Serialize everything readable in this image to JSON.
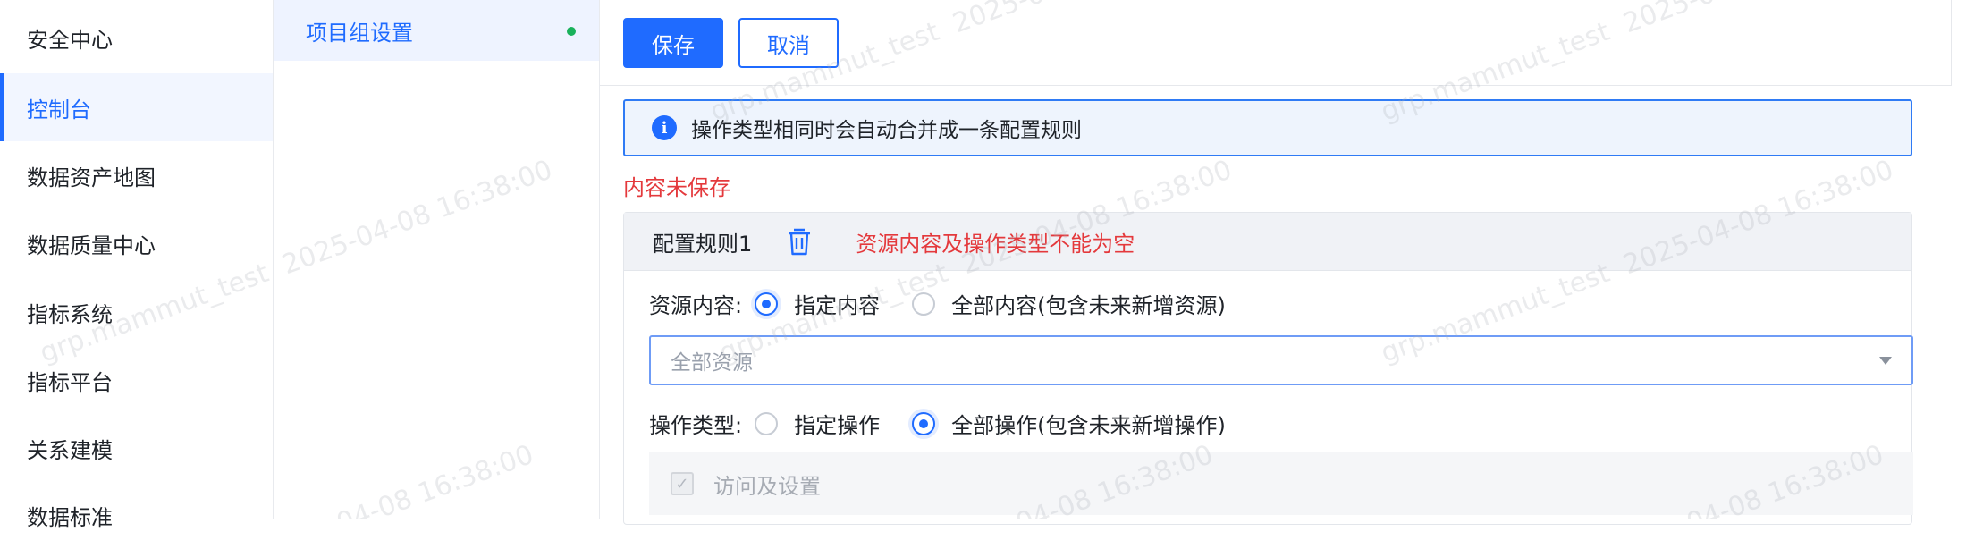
{
  "left_nav": {
    "items": [
      {
        "label": "安全中心",
        "active": false
      },
      {
        "label": "控制台",
        "active": true
      },
      {
        "label": "数据资产地图",
        "active": false
      },
      {
        "label": "数据质量中心",
        "active": false
      },
      {
        "label": "指标系统",
        "active": false
      },
      {
        "label": "指标平台",
        "active": false
      },
      {
        "label": "关系建模",
        "active": false
      },
      {
        "label": "数据标准",
        "active": false
      }
    ]
  },
  "mid_col": {
    "item_label": "项目组设置",
    "status_color": "#19b15b"
  },
  "toolbar": {
    "save_label": "保存",
    "cancel_label": "取消"
  },
  "info": {
    "icon": "info-icon",
    "message": "操作类型相同时会自动合并成一条配置规则"
  },
  "unsaved_text": "内容未保存",
  "rule": {
    "title": "配置规则1",
    "delete_icon": "trash-icon",
    "error": "资源内容及操作类型不能为空",
    "resource": {
      "label": "资源内容:",
      "options": [
        {
          "label": "指定内容",
          "checked": true
        },
        {
          "label": "全部内容(包含未来新增资源)",
          "checked": false
        }
      ],
      "select_placeholder": "全部资源"
    },
    "operation": {
      "label": "操作类型:",
      "options": [
        {
          "label": "指定操作",
          "checked": false
        },
        {
          "label": "全部操作(包含未来新增操作)",
          "checked": true
        }
      ]
    },
    "permissions": [
      {
        "label": "访问及设置",
        "checked": true,
        "disabled": true
      }
    ]
  },
  "watermark": {
    "user": "grp.mammut_test",
    "time": "2025-04-08 16:38:00"
  },
  "colors": {
    "primary": "#1f6bff",
    "error": "#e4393c",
    "success": "#19b15b"
  }
}
